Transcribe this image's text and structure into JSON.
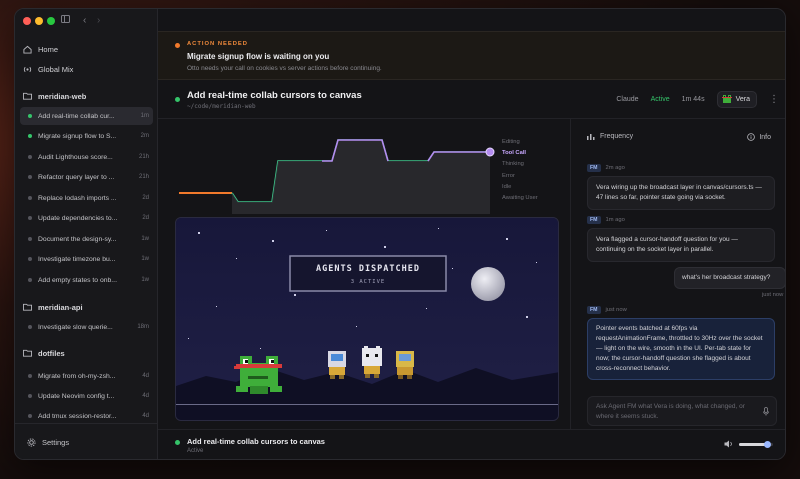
{
  "colors": {
    "accent_green": "#35c46a",
    "accent_orange": "#f27a2c",
    "tool_call_purple": "#b48cf0",
    "thinking_green": "#3ec48a"
  },
  "sidebar": {
    "nav": [
      {
        "label": "Home",
        "icon": "home-icon"
      },
      {
        "label": "Global Mix",
        "icon": "broadcast-icon"
      }
    ],
    "groups": [
      {
        "name": "meridian-web",
        "tasks": [
          {
            "label": "Add real-time collab cur...",
            "age": "1m",
            "status": "active"
          },
          {
            "label": "Migrate signup flow to S...",
            "age": "2m",
            "status": "active"
          },
          {
            "label": "Audit Lighthouse score...",
            "age": "21h",
            "status": "idle"
          },
          {
            "label": "Refactor query layer to ...",
            "age": "21h",
            "status": "idle"
          },
          {
            "label": "Replace lodash imports ...",
            "age": "2d",
            "status": "idle"
          },
          {
            "label": "Update dependencies to...",
            "age": "2d",
            "status": "idle"
          },
          {
            "label": "Document the design-sy...",
            "age": "1w",
            "status": "idle"
          },
          {
            "label": "Investigate timezone bu...",
            "age": "1w",
            "status": "idle"
          },
          {
            "label": "Add empty states to onb...",
            "age": "1w",
            "status": "idle"
          }
        ]
      },
      {
        "name": "meridian-api",
        "tasks": [
          {
            "label": "Investigate slow querie...",
            "age": "18m",
            "status": "idle"
          }
        ]
      },
      {
        "name": "dotfiles",
        "tasks": [
          {
            "label": "Migrate from oh-my-zsh...",
            "age": "4d",
            "status": "idle"
          },
          {
            "label": "Update Neovim config t...",
            "age": "4d",
            "status": "idle"
          },
          {
            "label": "Add tmux session-restor...",
            "age": "4d",
            "status": "idle"
          }
        ]
      }
    ],
    "settings_label": "Settings"
  },
  "banner": {
    "kicker": "ACTION NEEDED",
    "title": "Migrate signup flow is waiting on you",
    "subtitle": "Otto needs your call on cookies vs server actions before continuing."
  },
  "thread": {
    "title": "Add real-time collab cursors to canvas",
    "path": "~/code/meridian-web",
    "model": "Claude",
    "status": "Active",
    "duration": "1m 44s",
    "agent": "Vera"
  },
  "state_graph": {
    "states": [
      "Editing",
      "Tool Call",
      "Thinking",
      "Error",
      "Idle",
      "Awaiting User"
    ],
    "current": "Tool Call"
  },
  "scene": {
    "title": "AGENTS DISPATCHED",
    "subtitle": "3 ACTIVE"
  },
  "panel": {
    "title": "Frequency",
    "info_label": "Info",
    "messages": [
      {
        "sender": "FM",
        "time": "2m ago",
        "text": "Vera wiring up the broadcast layer in canvas/cursors.ts — 47 lines so far, pointer state going via socket."
      },
      {
        "sender": "FM",
        "time": "1m ago",
        "text": "Vera flagged a cursor-handoff question for you — continuing on the socket layer in parallel."
      },
      {
        "sender": "user",
        "time": "just now",
        "text": "what's her broadcast strategy?"
      },
      {
        "sender": "FM",
        "time": "just now",
        "text": "Pointer events batched at 60fps via requestAnimationFrame, throttled to 30Hz over the socket — light on the wire, smooth in the UI. Per-tab state for now; the cursor-handoff question she flagged is about cross-reconnect behavior."
      }
    ],
    "ask_placeholder": "Ask Agent FM what Vera is doing, what changed, or where it seems stuck."
  },
  "bottom_bar": {
    "title": "Add real-time collab cursors to canvas",
    "status": "Active",
    "volume": 0.85
  }
}
